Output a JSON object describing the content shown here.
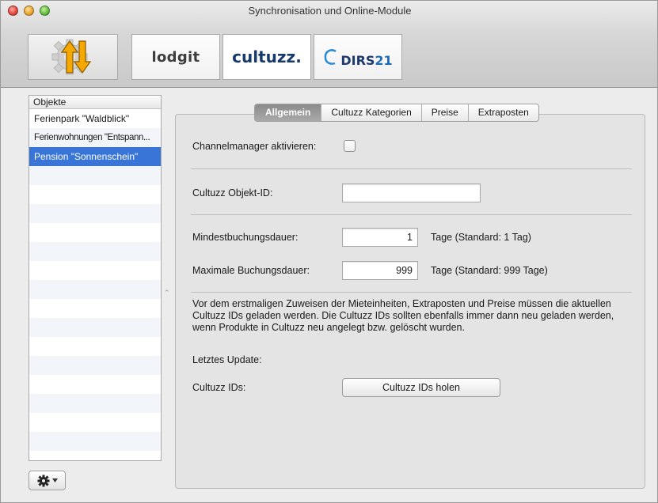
{
  "window": {
    "title": "Synchronisation und Online-Module"
  },
  "toolbar": {
    "lodgit_logo": "lodgit",
    "cultuzz_logo": "cultuzz.",
    "dirs_logo_main": "DIRS",
    "dirs_logo_num": "21"
  },
  "sidebar": {
    "header": "Objekte",
    "items": [
      {
        "label": "Ferienpark \"Waldblick\""
      },
      {
        "label": "Ferienwohnungen \"Entspann..."
      },
      {
        "label": "Pension \"Sonnenschein\""
      }
    ]
  },
  "tabs": [
    "Allgemein",
    "Cultuzz Kategorien",
    "Preise",
    "Extraposten"
  ],
  "form": {
    "channelmanager_label": "Channelmanager aktivieren:",
    "objekt_id_label": "Cultuzz Objekt-ID:",
    "objekt_id_value": "",
    "mindest_label": "Mindestbuchungsdauer:",
    "mindest_value": "1",
    "mindest_hint": "Tage (Standard: 1 Tag)",
    "max_label": "Maximale Buchungsdauer:",
    "max_value": "999",
    "max_hint": "Tage (Standard: 999 Tage)",
    "info_text": "Vor dem erstmaligen Zuweisen der Mieteinheiten, Extraposten und Preise müssen die aktuellen Cultuzz IDs geladen werden. Die Cultuzz IDs sollten ebenfalls immer dann neu geladen werden, wenn Produkte in Cultuzz neu angelegt bzw. gelöscht wurden.",
    "letztes_update_label": "Letztes Update:",
    "cultuzz_ids_label": "Cultuzz IDs:",
    "fetch_button": "Cultuzz IDs holen"
  },
  "colors": {
    "selection": "#3875d7",
    "accent_orange": "#f5a800"
  }
}
